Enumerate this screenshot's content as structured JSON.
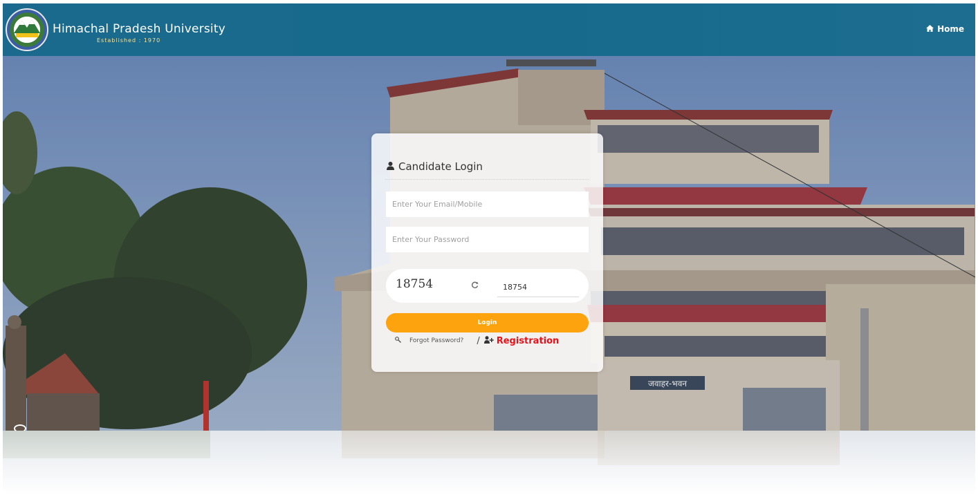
{
  "header": {
    "title": "Himachal Pradesh University",
    "subtitle": "Established : 1970",
    "home_label": "Home"
  },
  "hero": {
    "building_sign": "जवाहर-भवन"
  },
  "login": {
    "title": "Candidate Login",
    "email_placeholder": "Enter Your Email/Mobile",
    "password_placeholder": "Enter Your Password",
    "captcha_code": "18754",
    "captcha_value": "18754",
    "login_label": "Login",
    "forgot_label": "Forgot Password?",
    "separator": "/",
    "registration_label": "Registration"
  },
  "icons": [
    "university-logo-icon",
    "home-icon",
    "user-icon",
    "refresh-icon",
    "key-icon",
    "user-plus-icon"
  ],
  "colors": {
    "header_bg": "#176a8c",
    "login_button": "#fca30d",
    "registration_link": "#e8121a"
  }
}
